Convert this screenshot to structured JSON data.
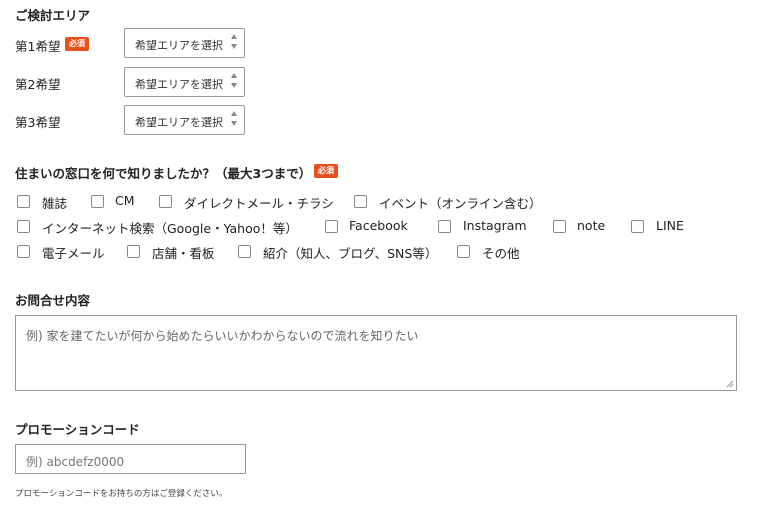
{
  "area": {
    "title": "ご検討エリア",
    "required_badge": "必須",
    "choices": [
      {
        "label": "第1希望",
        "select_value": "希望エリアを選択",
        "required": true
      },
      {
        "label": "第2希望",
        "select_value": "希望エリアを選択",
        "required": false
      },
      {
        "label": "第3希望",
        "select_value": "希望エリアを選択",
        "required": false
      }
    ]
  },
  "source": {
    "question": "住まいの窓口を何で知りましたか？（最大3つまで）",
    "required_badge": "必須",
    "options": [
      "雑誌",
      "CM",
      "ダイレクトメール・チラシ",
      "イベント（オンライン含む）",
      "インターネット検索（Google・Yahoo！等）",
      "Facebook",
      "Instagram",
      "note",
      "LINE",
      "電子メール",
      "店舗・看板",
      "紹介（知人、ブログ、SNS等）",
      "その他"
    ]
  },
  "inquiry": {
    "title": "お問合せ内容",
    "placeholder": "例) 家を建てたいが何から始めたらいいかわからないので流れを知りたい"
  },
  "promo": {
    "title": "プロモーションコード",
    "placeholder": "例) abcdefz0000",
    "note": "プロモーションコードをお持ちの方はご登録ください。"
  },
  "colors": {
    "badge": "#e8501c"
  }
}
